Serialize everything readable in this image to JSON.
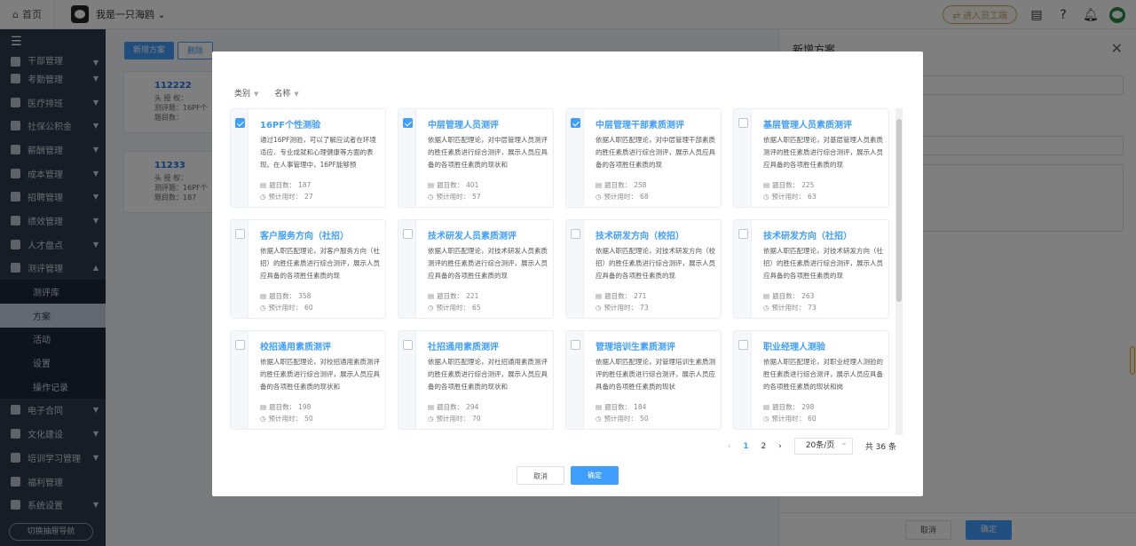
{
  "topbar": {
    "home": "首页",
    "user": "我是一只海鸥",
    "switch_label": "进入员工端"
  },
  "sidebar": {
    "items": [
      {
        "label": "干部管理",
        "arrow": true
      },
      {
        "label": "考勤管理",
        "arrow": true
      },
      {
        "label": "医疗排班",
        "arrow": true
      },
      {
        "label": "社保公积金",
        "arrow": true
      },
      {
        "label": "薪酬管理",
        "arrow": true
      },
      {
        "label": "成本管理",
        "arrow": true
      },
      {
        "label": "招聘管理",
        "arrow": true
      },
      {
        "label": "绩效管理",
        "arrow": true
      },
      {
        "label": "人才盘点",
        "arrow": true
      },
      {
        "label": "测评管理",
        "arrow": true
      }
    ],
    "subitems": [
      "测评库",
      "方案",
      "活动",
      "设置",
      "操作记录"
    ],
    "items2": [
      {
        "label": "电子合同",
        "arrow": true
      },
      {
        "label": "文化建设",
        "arrow": true
      },
      {
        "label": "培训学习管理",
        "arrow": true
      },
      {
        "label": "福利管理",
        "arrow": false
      },
      {
        "label": "系统设置",
        "arrow": true
      }
    ],
    "bottom": "切换抽屉导航"
  },
  "background": {
    "new_btn": "新增方案",
    "del_btn": "删除",
    "cards": [
      {
        "title": "112222",
        "l1": "头 授 权：",
        "l2": "测评题：16PF个",
        "l3": "题目数："
      },
      {
        "title": "11233",
        "l1": "头 授 权：",
        "l2": "测评题：16PF个",
        "l3": "题目数：187"
      }
    ]
  },
  "drawer": {
    "title": "新增方案",
    "cancel": "取消",
    "confirm": "确定"
  },
  "modal": {
    "filters": [
      "类别",
      "名称"
    ],
    "meta_count_label": "题目数：",
    "meta_time_label": "预计用时：",
    "cards": [
      {
        "title": "16PF个性测验",
        "checked": true,
        "desc": "通过16PF测验，可以了解应试者在环境适应、专业成就和心理健康等方面的表现。在人事管理中，16PF能够预",
        "count": "187",
        "time": "27"
      },
      {
        "title": "中层管理人员测评",
        "checked": true,
        "desc": "依据人职匹配理论，对中层管理人员测评的胜任素质进行综合测评，展示人员应具备的各项胜任素质的现状和",
        "count": "401",
        "time": "57"
      },
      {
        "title": "中层管理干部素质测评",
        "checked": true,
        "desc": "依据人职匹配理论，对中层管理干部素质的胜任素质进行综合测评，展示人员应具备的各项胜任素质的现",
        "count": "258",
        "time": "68"
      },
      {
        "title": "基层管理人员素质测评",
        "checked": false,
        "desc": "依据人职匹配理论，对基层管理人员素质测评的胜任素质进行综合测评，展示人员应具备的各项胜任素质的现",
        "count": "225",
        "time": "63"
      },
      {
        "title": "客户服务方向（社招）",
        "checked": false,
        "desc": "依据人职匹配理论，对客户服务方向（社招）的胜任素质进行综合测评，展示人员应具备的各项胜任素质的现",
        "count": "358",
        "time": "60"
      },
      {
        "title": "技术研发人员素质测评",
        "checked": false,
        "desc": "依据人职匹配理论，对技术研发人员素质测评的胜任素质进行综合测评，展示人员应具备的各项胜任素质的现",
        "count": "221",
        "time": "65"
      },
      {
        "title": "技术研发方向（校招）",
        "checked": false,
        "desc": "依据人职匹配理论，对技术研发方向（校招）的胜任素质进行综合测评，展示人员应具备的各项胜任素质的现",
        "count": "271",
        "time": "73"
      },
      {
        "title": "技术研发方向（社招）",
        "checked": false,
        "desc": "依据人职匹配理论，对技术研发方向（社招）的胜任素质进行综合测评，展示人员应具备的各项胜任素质的现",
        "count": "263",
        "time": "73"
      },
      {
        "title": "校招通用素质测评",
        "checked": false,
        "desc": "依据人职匹配理论，对校招通用素质测评的胜任素质进行综合测评，展示人员应具备的各项胜任素质的现状和",
        "count": "198",
        "time": "50"
      },
      {
        "title": "社招通用素质测评",
        "checked": false,
        "desc": "依据人职匹配理论，对社招通用素质测评的胜任素质进行综合测评，展示人员应具备的各项胜任素质的现状和",
        "count": "294",
        "time": "70"
      },
      {
        "title": "管理培训生素质测评",
        "checked": false,
        "desc": "依据人职匹配理论，对管理培训生素质测评的胜任素质进行综合测评，展示人员应具备的各项胜任素质的现状",
        "count": "184",
        "time": "50"
      },
      {
        "title": "职业经理人测验",
        "checked": false,
        "desc": "依据人职匹配理论，对职业经理人测验的胜任素质进行综合测评，展示人员应具备的各项胜任素质的现状和岗",
        "count": "298",
        "time": "60"
      }
    ],
    "pager": {
      "prev": "‹",
      "pages": [
        "1",
        "2"
      ],
      "current": "1",
      "next": "›",
      "size": "20条/页",
      "total": "共 36 条"
    },
    "cancel": "取消",
    "confirm": "确定"
  }
}
